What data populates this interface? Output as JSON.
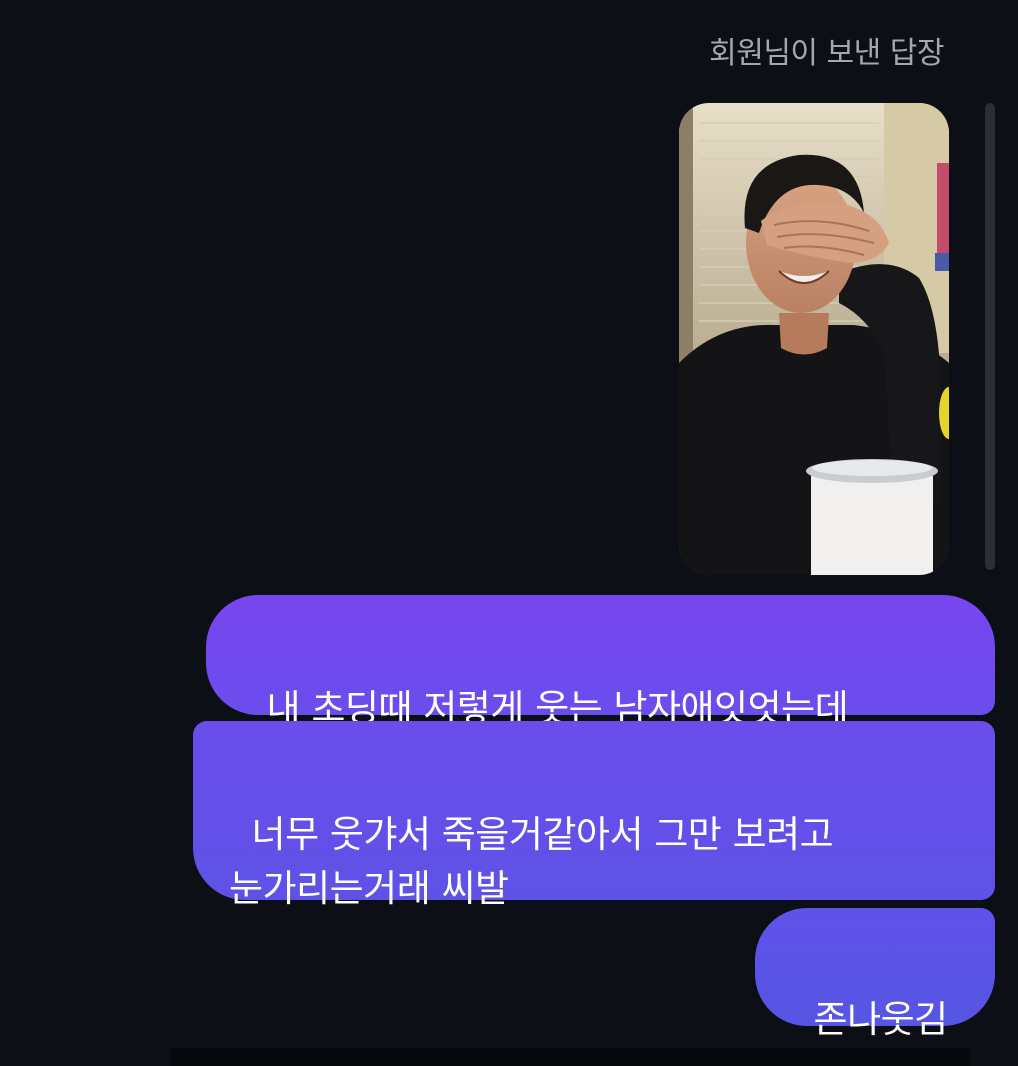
{
  "chat": {
    "reply_header": "회원님이 보낸 답장",
    "reply_photo": {
      "description_icon": "photo-thumbnail"
    },
    "messages": [
      {
        "text": "내 초딩때 저렇게 웃는 남자애잇엇는데"
      },
      {
        "text": "너무 웃갸서 죽을거같아서 그만 보려고\n눈가리는거래 씨발"
      },
      {
        "text": "존나웃김"
      }
    ]
  },
  "colors": {
    "background": "#0c0f15",
    "header_text": "#a4a7ae",
    "bubble_top": "#7845ee",
    "bubble_bottom": "#5656e3"
  }
}
